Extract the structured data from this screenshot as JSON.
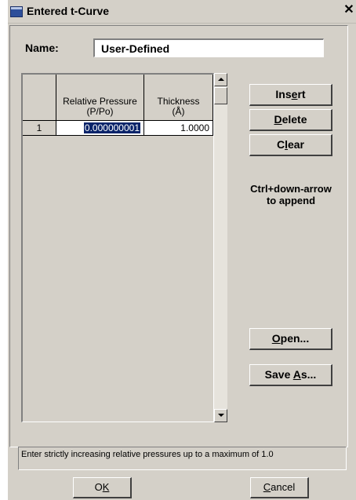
{
  "window": {
    "title": "Entered t-Curve",
    "close_glyph": "✕"
  },
  "name": {
    "label": "Name:",
    "value": "User-Defined"
  },
  "table": {
    "columns": [
      "",
      "Relative Pressure (P/Po)",
      "Thickness (Å)"
    ],
    "header_lines": {
      "pressure_1": "Relative Pressure",
      "pressure_2": "(P/Po)",
      "thickness_1": "Thickness",
      "thickness_2": "(Å)"
    },
    "rows": [
      {
        "num": "1",
        "pressure": "0.000000001",
        "thickness": "1.0000"
      }
    ]
  },
  "buttons": {
    "insert": {
      "pre": "Ins",
      "key": "e",
      "post": "rt"
    },
    "delete": {
      "pre": "",
      "key": "D",
      "post": "elete"
    },
    "clear": {
      "pre": "C",
      "key": "l",
      "post": "ear"
    },
    "open": {
      "pre": "",
      "key": "O",
      "post": "pen..."
    },
    "save_as": {
      "pre": "Save ",
      "key": "A",
      "post": "s..."
    },
    "ok": {
      "pre": "O",
      "key": "K",
      "post": ""
    },
    "cancel": {
      "pre": "",
      "key": "C",
      "post": "ancel"
    }
  },
  "hint": {
    "line1": "Ctrl+down-arrow",
    "line2": "to append"
  },
  "status": "Enter strictly increasing relative pressures up to a maximum of 1.0",
  "icons": {
    "window_icon": "window-icon",
    "close": "close-icon",
    "scroll_up": "arrow-up-icon",
    "scroll_down": "arrow-down-icon"
  }
}
